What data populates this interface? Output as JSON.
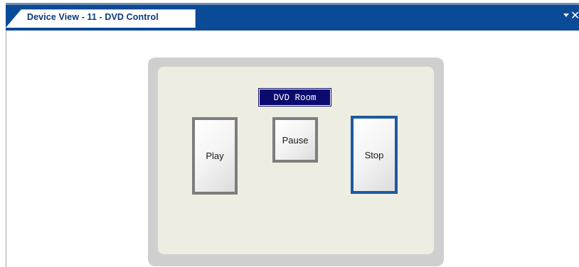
{
  "tab": {
    "title": "Device View - 11 - DVD Control"
  },
  "panel": {
    "room_label": "DVD Room",
    "buttons": {
      "play": "Play",
      "pause": "Pause",
      "stop": "Stop"
    }
  },
  "icons": {
    "tab_menu": "chevron-down-icon",
    "tab_close": "close-icon"
  },
  "colors": {
    "tab_strip": "#0a4a96",
    "room_label_bg": "#0b0b6e",
    "panel_bg": "#eeede1",
    "panel_frame": "#cfcfcf",
    "selected_button_border": "#1b5aa3"
  }
}
